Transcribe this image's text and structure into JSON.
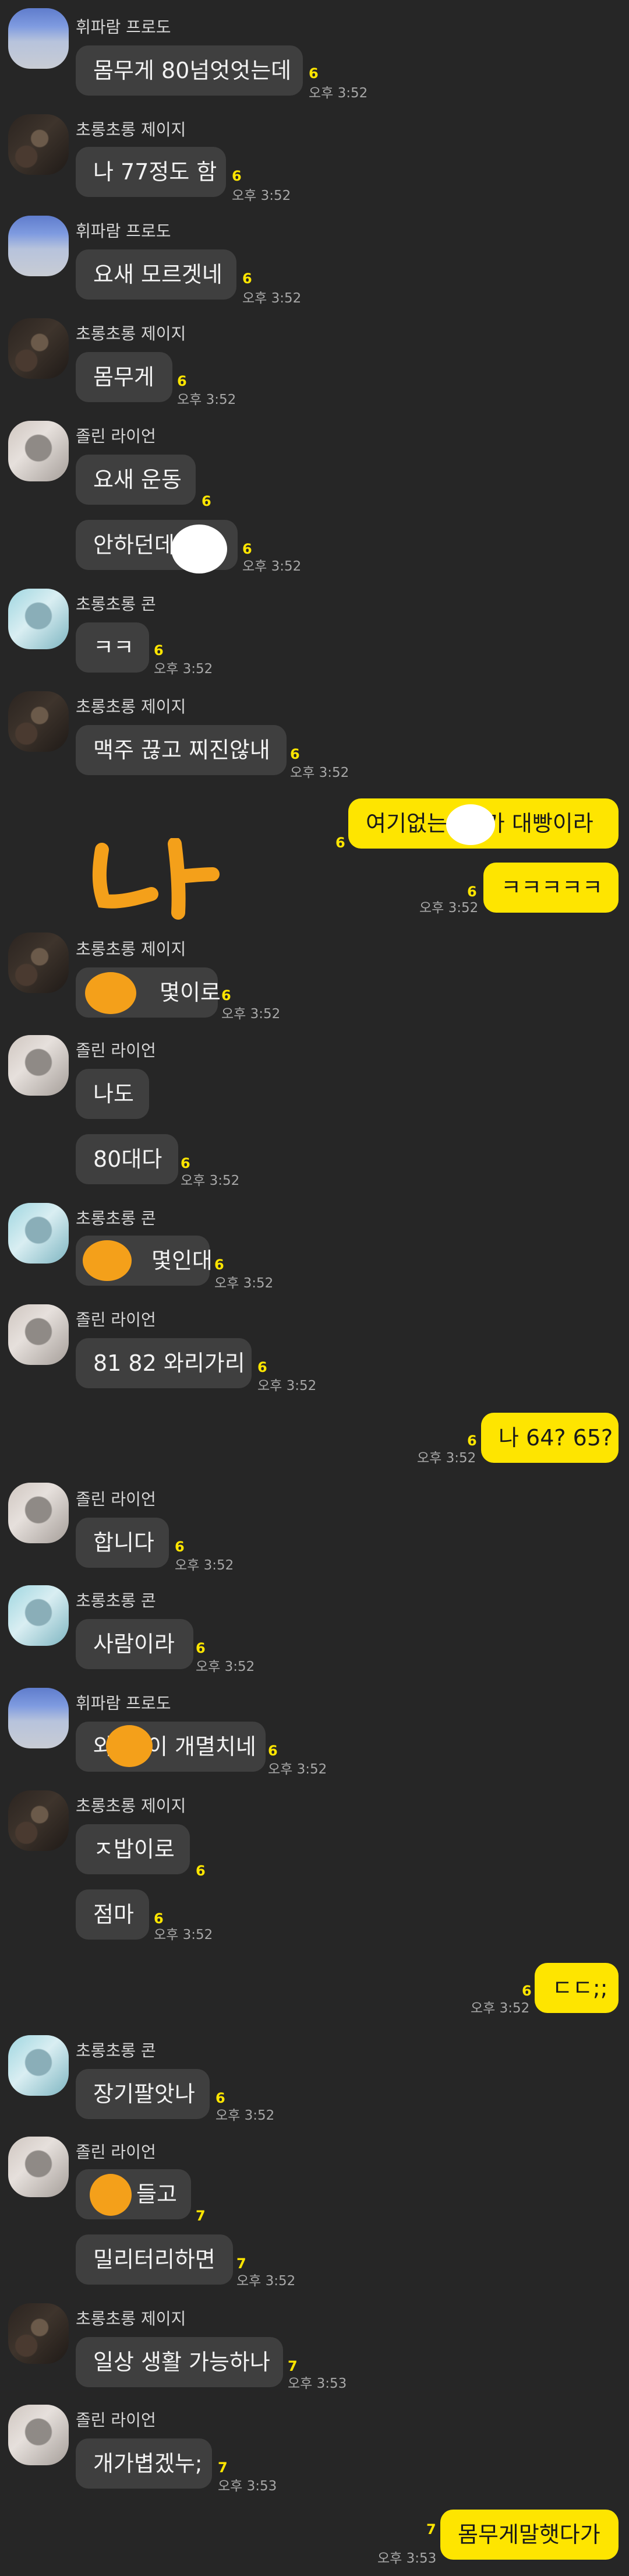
{
  "users": {
    "frodo": "휘파람 프로도",
    "jayz": "초롱초롱 제이지",
    "ryan": "졸린 라이언",
    "con": "초롱초롱 콘"
  },
  "messages": [
    {
      "text": "몸무게 80넘엇엇는데",
      "unread": "6",
      "time": "오후 3:52"
    },
    {
      "text": "나 77정도 함",
      "unread": "6",
      "time": "오후 3:52"
    },
    {
      "text": "요새 모르겟네",
      "unread": "6",
      "time": "오후 3:52"
    },
    {
      "text": "몸무게",
      "unread": "6",
      "time": "오후 3:52"
    },
    {
      "text": "요새 운동",
      "unread": "6",
      "time": ""
    },
    {
      "text": "안하던데",
      "unread": "6",
      "time": "오후 3:52"
    },
    {
      "text": "ㅋㅋ",
      "unread": "6",
      "time": "오후 3:52"
    },
    {
      "text": "맥주 끊고 찌진않내",
      "unread": "6",
      "time": "오후 3:52"
    },
    {
      "text_a": "여기없는",
      "text_b": "가 대빵이라",
      "unread": "6",
      "time": ""
    },
    {
      "text": "ㅋㅋㅋㅋㅋ",
      "unread": "6",
      "time": "오후 3:52"
    },
    {
      "text": "나",
      "sticker": true
    },
    {
      "text": "몇이로",
      "unread": "6",
      "time": "오후 3:52"
    },
    {
      "text": "나도",
      "unread": "",
      "time": ""
    },
    {
      "text": "80대다",
      "unread": "6",
      "time": "오후 3:52"
    },
    {
      "text": "몇인대",
      "unread": "6",
      "time": "오후 3:52"
    },
    {
      "text": "81 82 와리가리",
      "unread": "6",
      "time": "오후 3:52"
    },
    {
      "text": "나 64? 65?",
      "unread": "6",
      "time": "오후 3:52"
    },
    {
      "text": "합니다",
      "unread": "6",
      "time": "오후 3:52"
    },
    {
      "text": "사람이라",
      "unread": "6",
      "time": "오후 3:52"
    },
    {
      "text_a": "와",
      "text_b": "이 개멸치네",
      "unread": "6",
      "time": "오후 3:52"
    },
    {
      "text": "ㅈ밥이로",
      "unread": "6",
      "time": ""
    },
    {
      "text": "점마",
      "unread": "6",
      "time": "오후 3:52"
    },
    {
      "text": "ㄷㄷ;;",
      "unread": "6",
      "time": "오후 3:52"
    },
    {
      "text": "장기팔앗나",
      "unread": "6",
      "time": "오후 3:52"
    },
    {
      "text": "들고",
      "unread": "7",
      "time": ""
    },
    {
      "text": "밀리터리하면",
      "unread": "7",
      "time": "오후 3:52"
    },
    {
      "text": "일상 생활 가능하나",
      "unread": "7",
      "time": "오후 3:53"
    },
    {
      "text": "개가볍겠누;",
      "unread": "7",
      "time": "오후 3:53"
    },
    {
      "text": "몸무게말햇다가",
      "unread": "7",
      "time": "오후 3:53"
    }
  ]
}
